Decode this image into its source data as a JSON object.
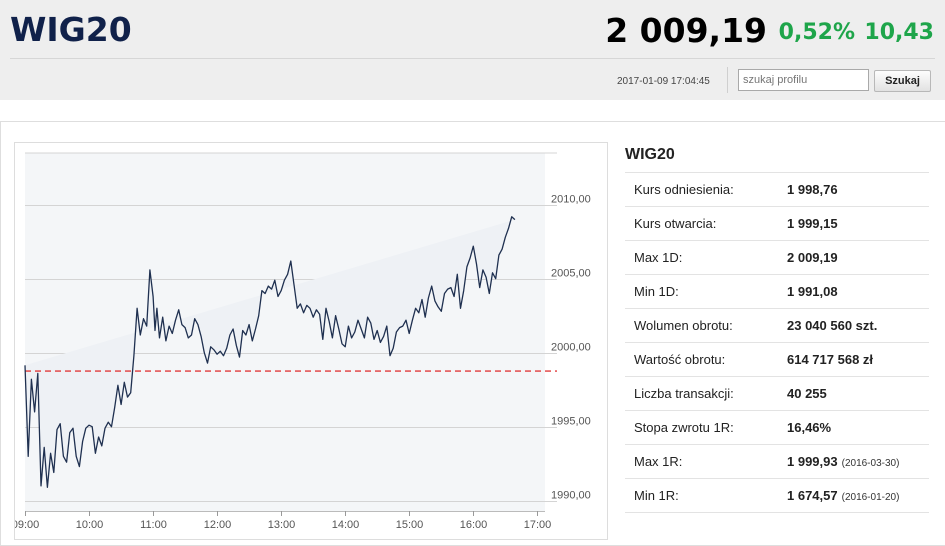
{
  "header": {
    "title": "WIG20",
    "price": "2 009,19",
    "change_pct": "0,52%",
    "change_abs": "10,43",
    "timestamp": "2017-01-09 17:04:45",
    "search_placeholder": "szukaj profilu",
    "search_button": "Szukaj"
  },
  "colors": {
    "title": "#10214a",
    "positive": "#1ea54a",
    "line": "#1f3050",
    "reference_line": "#e03a3a",
    "chart_fill": "#f4f6f8"
  },
  "info": {
    "title": "WIG20",
    "rows": [
      {
        "label": "Kurs odniesienia:",
        "value": "1 998,76",
        "extra": ""
      },
      {
        "label": "Kurs otwarcia:",
        "value": "1 999,15",
        "extra": ""
      },
      {
        "label": "Max 1D:",
        "value": "2 009,19",
        "extra": ""
      },
      {
        "label": "Min 1D:",
        "value": "1 991,08",
        "extra": ""
      },
      {
        "label": "Wolumen obrotu:",
        "value": "23 040 560 szt.",
        "extra": ""
      },
      {
        "label": "Wartość obrotu:",
        "value": "614 717 568 zł",
        "extra": ""
      },
      {
        "label": "Liczba transakcji:",
        "value": "40 255",
        "extra": ""
      },
      {
        "label": "Stopa zwrotu 1R:",
        "value": "16,46%",
        "extra": ""
      },
      {
        "label": "Max 1R:",
        "value": "1 999,93",
        "extra": "(2016-03-30)"
      },
      {
        "label": "Min 1R:",
        "value": "1 674,57",
        "extra": "(2016-01-20)"
      }
    ]
  },
  "chart_data": {
    "type": "line",
    "reference_value": 1998.76,
    "ylim": [
      1989.3,
      2013.5
    ],
    "xlim": [
      9.0,
      17.12
    ],
    "y_ticks": [
      {
        "value": 1990,
        "label": "1990,00"
      },
      {
        "value": 1995,
        "label": "1995,00"
      },
      {
        "value": 2000,
        "label": "2000,00"
      },
      {
        "value": 2005,
        "label": "2005,00"
      },
      {
        "value": 2010,
        "label": "2010,00"
      }
    ],
    "x_ticks": [
      {
        "value": 9,
        "label": "09:00"
      },
      {
        "value": 10,
        "label": "10:00"
      },
      {
        "value": 11,
        "label": "11:00"
      },
      {
        "value": 12,
        "label": "12:00"
      },
      {
        "value": 13,
        "label": "13:00"
      },
      {
        "value": 14,
        "label": "14:00"
      },
      {
        "value": 15,
        "label": "15:00"
      },
      {
        "value": 16,
        "label": "16:00"
      },
      {
        "value": 17,
        "label": "17:00"
      }
    ],
    "x": [
      9.0,
      9.05,
      9.1,
      9.15,
      9.2,
      9.25,
      9.3,
      9.35,
      9.4,
      9.45,
      9.5,
      9.55,
      9.6,
      9.65,
      9.7,
      9.75,
      9.8,
      9.85,
      9.9,
      9.95,
      10.0,
      10.05,
      10.1,
      10.15,
      10.2,
      10.25,
      10.3,
      10.35,
      10.4,
      10.45,
      10.5,
      10.55,
      10.6,
      10.65,
      10.7,
      10.75,
      10.8,
      10.85,
      10.9,
      10.95,
      11.0,
      11.03,
      11.06,
      11.1,
      11.15,
      11.2,
      11.25,
      11.3,
      11.35,
      11.4,
      11.45,
      11.5,
      11.55,
      11.6,
      11.65,
      11.7,
      11.75,
      11.8,
      11.85,
      11.9,
      11.95,
      12.0,
      12.05,
      12.1,
      12.15,
      12.2,
      12.25,
      12.3,
      12.35,
      12.4,
      12.45,
      12.5,
      12.55,
      12.6,
      12.65,
      12.7,
      12.75,
      12.8,
      12.85,
      12.9,
      12.95,
      13.0,
      13.05,
      13.1,
      13.15,
      13.2,
      13.25,
      13.3,
      13.35,
      13.4,
      13.45,
      13.5,
      13.55,
      13.6,
      13.65,
      13.7,
      13.75,
      13.8,
      13.85,
      13.9,
      13.95,
      14.0,
      14.05,
      14.1,
      14.15,
      14.2,
      14.25,
      14.3,
      14.35,
      14.4,
      14.45,
      14.5,
      14.55,
      14.6,
      14.65,
      14.7,
      14.75,
      14.8,
      14.85,
      14.9,
      14.95,
      15.0,
      15.05,
      15.1,
      15.15,
      15.2,
      15.25,
      15.3,
      15.35,
      15.4,
      15.45,
      15.5,
      15.55,
      15.6,
      15.65,
      15.7,
      15.75,
      15.8,
      15.85,
      15.9,
      15.95,
      16.0,
      16.05,
      16.1,
      16.15,
      16.2,
      16.25,
      16.3,
      16.35,
      16.4,
      16.45,
      16.5,
      16.55,
      16.6,
      16.65,
      16.7,
      16.75,
      16.8,
      16.85,
      16.9,
      16.95,
      17.0,
      17.05,
      17.08
    ],
    "y": [
      1999.15,
      1993.0,
      1998.2,
      1996.0,
      1998.6,
      1991.0,
      1993.6,
      1990.9,
      1993.2,
      1991.9,
      1994.8,
      1995.2,
      1993.0,
      1992.6,
      1994.6,
      1994.9,
      1993.0,
      1992.3,
      1994.0,
      1994.9,
      1995.1,
      1995.0,
      1993.2,
      1994.3,
      1993.7,
      1994.9,
      1995.3,
      1995.0,
      1996.3,
      1997.8,
      1996.5,
      1998.0,
      1997.0,
      1997.3,
      1999.8,
      2003.0,
      2001.2,
      2002.3,
      2001.8,
      2005.6,
      2003.8,
      2001.5,
      2003.0,
      2001.0,
      2002.4,
      2000.8,
      2001.8,
      2001.3,
      2002.2,
      2002.9,
      2001.9,
      2001.7,
      2001.0,
      2001.2,
      2002.3,
      2001.9,
      2001.1,
      2000.0,
      1999.3,
      2000.4,
      2000.2,
      1999.9,
      2000.1,
      1999.8,
      2000.3,
      2001.2,
      2001.6,
      2000.5,
      1999.7,
      2001.5,
      2001.2,
      2001.9,
      2000.8,
      2001.6,
      2002.5,
      2004.2,
      2004.0,
      2004.5,
      2004.3,
      2004.9,
      2003.8,
      2004.2,
      2004.9,
      2005.3,
      2006.2,
      2004.6,
      2003.0,
      2003.3,
      2002.7,
      2003.2,
      2003.0,
      2002.4,
      2002.9,
      2002.6,
      2000.9,
      2003.0,
      2002.1,
      2001.0,
      2002.5,
      2001.6,
      2000.6,
      2000.4,
      2001.8,
      2001.0,
      2001.4,
      2002.2,
      2001.6,
      2001.0,
      2002.4,
      2002.0,
      2000.9,
      2001.5,
      2000.7,
      2001.1,
      2001.8,
      1999.8,
      2000.3,
      2001.4,
      2001.7,
      2001.8,
      2002.2,
      2001.3,
      2002.2,
      2003.0,
      2002.7,
      2003.6,
      2002.4,
      2003.7,
      2004.5,
      2003.5,
      2003.1,
      2002.8,
      2004.0,
      2004.3,
      2004.4,
      2003.8,
      2005.3,
      2003.0,
      2004.2,
      2005.8,
      2006.4,
      2007.2,
      2006.0,
      2004.4,
      2005.6,
      2005.1,
      2004.0,
      2005.4,
      2005.0,
      2006.6,
      2007.0,
      2007.8,
      2008.4,
      2009.19,
      2009.0
    ]
  }
}
